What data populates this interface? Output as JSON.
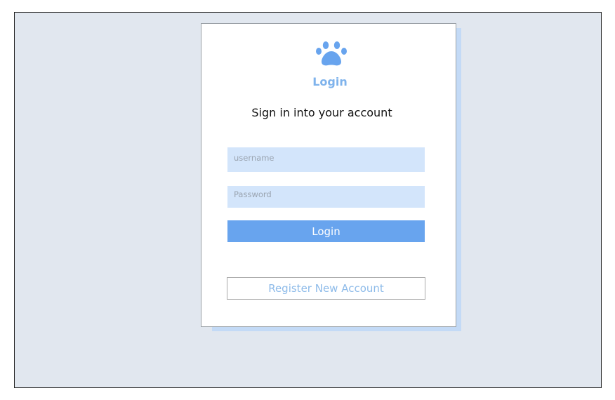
{
  "login_card": {
    "brand_title": "Login",
    "subtitle": "Sign in into your account",
    "logo_icon": "paw-icon",
    "username_placeholder": "username",
    "password_placeholder": "Password",
    "login_label": "Login",
    "register_label": "Register New Account"
  },
  "colors": {
    "background": "#e1e7ef",
    "accent": "#68a4ee",
    "input_fill": "#d3e5fb",
    "brand_text": "#7fb3ec",
    "card_shadow": "#c3daf6"
  }
}
